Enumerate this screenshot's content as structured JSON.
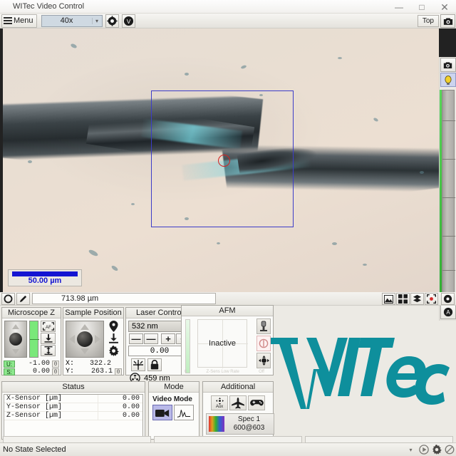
{
  "window": {
    "title": "WITec Video Control",
    "minimize": "—",
    "maximize": "□",
    "close": "✕"
  },
  "toolbar": {
    "menu_label": "Menu",
    "objective_value": "40x",
    "objective_arrow": "▾",
    "icon_target": "crosshair-target-icon",
    "icon_v": "v-badge-icon",
    "top_label": "Top",
    "camera_icon": "camera-icon"
  },
  "video": {
    "scalebar_text": "50.00 µm",
    "light_icon": "lightbulb-icon",
    "camera_icon": "camera-icon",
    "autofocus_icon": "a-badge-icon"
  },
  "strip": {
    "circle_icon": "circle-outline-icon",
    "pencil_icon": "pencil-icon",
    "distance_value": "713.98 µm",
    "icon_image": "image-icon",
    "icon_grid": "grid-icon",
    "icon_layers": "layers-icon",
    "icon_target": "focus-target-icon",
    "icon_settings": "settings-icon"
  },
  "microscope_z": {
    "title": "Microscope Z",
    "autofocus_label": "AF",
    "btn_autofocus": "autofocus-button",
    "btn_down": "move-down-button",
    "btn_range": "z-range-button",
    "rows": [
      {
        "tag": "U:",
        "value": "-1.00",
        "unit_btn": "0"
      },
      {
        "tag": "S:",
        "value": "0.00",
        "unit_btn": "0"
      }
    ]
  },
  "sample_position": {
    "title": "Sample Position",
    "btn_marker": "marker-button",
    "btn_down": "move-down-button",
    "btn_settings": "settings-button",
    "rows": [
      {
        "label": "X:",
        "value": "322.2"
      },
      {
        "label": "Y:",
        "value": "263.1"
      }
    ],
    "zero_btn": "0"
  },
  "laser_control": {
    "title": "Laser Control",
    "wavelength_selected": "532 nm",
    "arrow": "▾",
    "buttons": [
      "—",
      "—",
      "+",
      "+"
    ],
    "power_value": "0.00",
    "btn_laser": "laser-burst-button",
    "btn_lock": "lock-button",
    "aperture_icon": "aperture-icon",
    "secondary_wavelength": "459 nm"
  },
  "afm": {
    "title": "AFM",
    "state": "Inactive",
    "btn_tip": "tip-approach-button",
    "btn_circle": "feedback-circle-button",
    "btn_move": "move-stage-button",
    "faint_left": "0",
    "faint_mid": "Z-Sens Low Rate",
    "faint_right": "Off"
  },
  "status": {
    "title": "Status",
    "rows": [
      {
        "name": "X-Sensor [µm]",
        "value": "0.00"
      },
      {
        "name": "Y-Sensor [µm]",
        "value": "0.00"
      },
      {
        "name": "Z-Sensor [µm]",
        "value": "0.00"
      }
    ]
  },
  "mode": {
    "title": "Mode",
    "label": "Video Mode",
    "btn_video": "video-camera-button",
    "btn_spectrum": "spectrum-button"
  },
  "additional": {
    "title": "Additional",
    "aux_label": "Aux",
    "btn_aux": "aux-button",
    "btn_plane": "airplane-button",
    "btn_gamepad": "gamepad-button",
    "spec_name": "Spec 1",
    "spec_detail": "600@603"
  },
  "logo": {
    "text": "WITec",
    "color": "#0e8f9c"
  },
  "statusbar": {
    "text": "No State Selected",
    "arrow": "▾",
    "btn_play": "play-button",
    "btn_gear": "gear-button",
    "btn_disabled": "no-entry-button"
  }
}
